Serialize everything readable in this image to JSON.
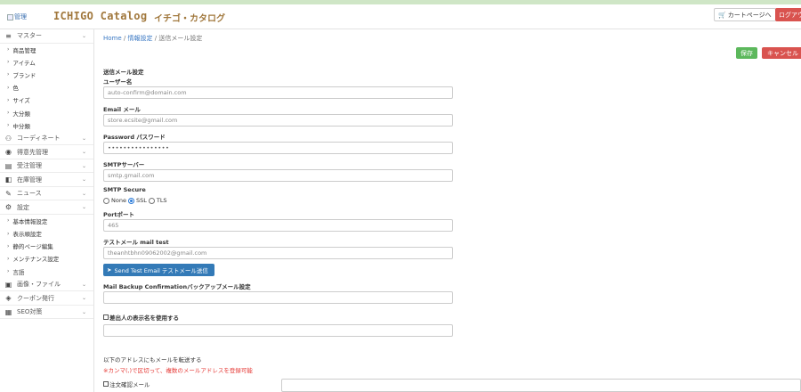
{
  "header": {
    "logo_alt": "管理",
    "brand": "ICHIGO Catalog",
    "brand_jp": "イチゴ・カタログ",
    "cart_label": "カートページへ",
    "logout_label": "ログアウト"
  },
  "sidebar": {
    "master": "マスター",
    "master_items": [
      "商品管理",
      "アイテム",
      "ブランド",
      "色",
      "サイズ",
      "大分類",
      "中分類"
    ],
    "coordinate": "コーディネート",
    "customer": "得意先管理",
    "order": "受注管理",
    "stock": "在庫管理",
    "news": "ニュース",
    "settings": "設定",
    "settings_items": [
      "基本情報設定",
      "表示順設定",
      "静的ページ編集",
      "メンテナンス設定",
      "言語"
    ],
    "images": "画像・ファイル",
    "coupon": "クーポン発行",
    "seo": "SEO対策"
  },
  "breadcrumb": {
    "home": "Home",
    "info": "情報設定",
    "sep1": "/",
    "sep2": "/",
    "current": "送信メール設定"
  },
  "actions": {
    "save": "保存",
    "cancel": "キャンセル"
  },
  "form": {
    "section_title": "送信メール設定",
    "username_label": "ユーザー名",
    "username_value": "auto-confirm@domain.com",
    "email_label": "Email メール",
    "email_value": "store.ecsite@gmail.com",
    "password_label": "Password パスワード",
    "password_value": "••••••••••••••••",
    "smtp_label": "SMTPサーバー",
    "smtp_value": "smtp.gmail.com",
    "secure_label": "SMTP Secure",
    "secure_none": "None",
    "secure_ssl": "SSL",
    "secure_tls": "TLS",
    "port_label": "Portポート",
    "port_value": "465",
    "test_label": "テストメール mail test",
    "test_value": "theanhtbhn09062002@gmail.com",
    "test_button": "Send Test Email テストメール送信",
    "backup_label": "Mail Backup Confirmationバックアップメール設定",
    "sender_name_label": "差出人の表示名を使用する",
    "forward_text": "以下のアドレスにもメールを転送する",
    "forward_note": "※カンマ(,)で区切って、複数のメールアドレスを登録可能",
    "order_confirm_label": "注文確認メール"
  }
}
